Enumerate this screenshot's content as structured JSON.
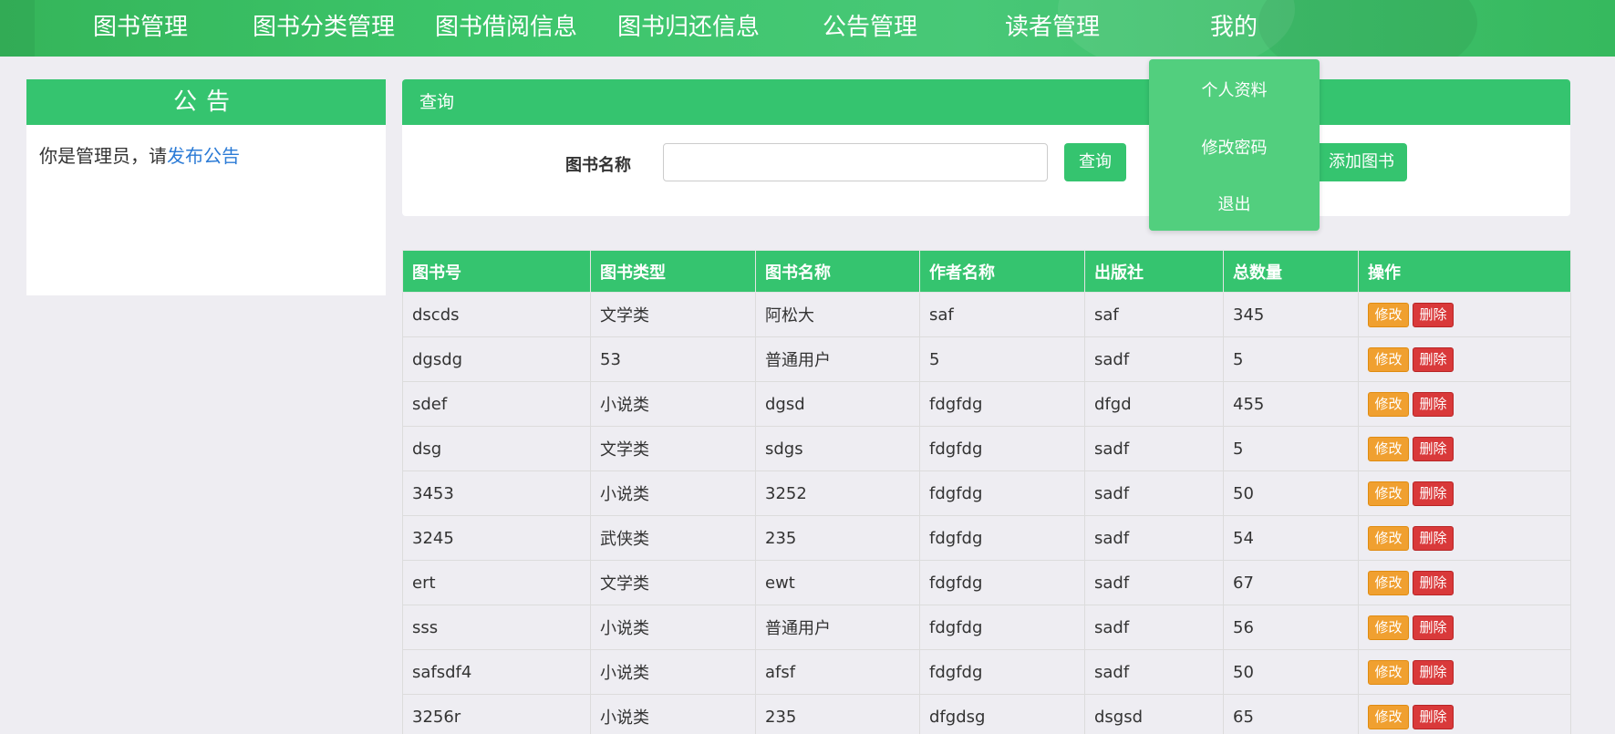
{
  "nav": {
    "items": [
      "图书管理",
      "图书分类管理",
      "图书借阅信息",
      "图书归还信息",
      "公告管理",
      "读者管理",
      "我的"
    ]
  },
  "dropdown": {
    "items": [
      "个人资料",
      "修改密码",
      "退出"
    ]
  },
  "notice": {
    "title": "公告",
    "text": "你是管理员，请",
    "link": "发布公告"
  },
  "query": {
    "title": "查询",
    "label": "图书名称",
    "input_value": "",
    "search_button": "查询",
    "add_button": "添加图书"
  },
  "table": {
    "headers": [
      "图书号",
      "图书类型",
      "图书名称",
      "作者名称",
      "出版社",
      "总数量",
      "操作"
    ],
    "edit_label": "修改",
    "delete_label": "删除",
    "rows": [
      [
        "dscds",
        "文学类",
        "阿松大",
        "saf",
        "saf",
        "345"
      ],
      [
        "dgsdg",
        "53",
        "普通用户",
        "5",
        "sadf",
        "5"
      ],
      [
        "sdef",
        "小说类",
        "dgsd",
        "fdgfdg",
        "dfgd",
        "455"
      ],
      [
        "dsg",
        "文学类",
        "sdgs",
        "fdgfdg",
        "sadf",
        "5"
      ],
      [
        "3453",
        "小说类",
        "3252",
        "fdgfdg",
        "sadf",
        "50"
      ],
      [
        "3245",
        "武侠类",
        "235",
        "fdgfdg",
        "sadf",
        "54"
      ],
      [
        "ert",
        "文学类",
        "ewt",
        "fdgfdg",
        "sadf",
        "67"
      ],
      [
        "sss",
        "小说类",
        "普通用户",
        "fdgfdg",
        "sadf",
        "56"
      ],
      [
        "safsdf4",
        "小说类",
        "afsf",
        "fdgfdg",
        "sadf",
        "50"
      ],
      [
        "3256r",
        "小说类",
        "235",
        "dfgdsg",
        "dsgsd",
        "65"
      ]
    ]
  },
  "colors": {
    "primary": "#35c46f",
    "edit": "#f0a030",
    "delete": "#d9393a",
    "link": "#2b7bd6"
  }
}
